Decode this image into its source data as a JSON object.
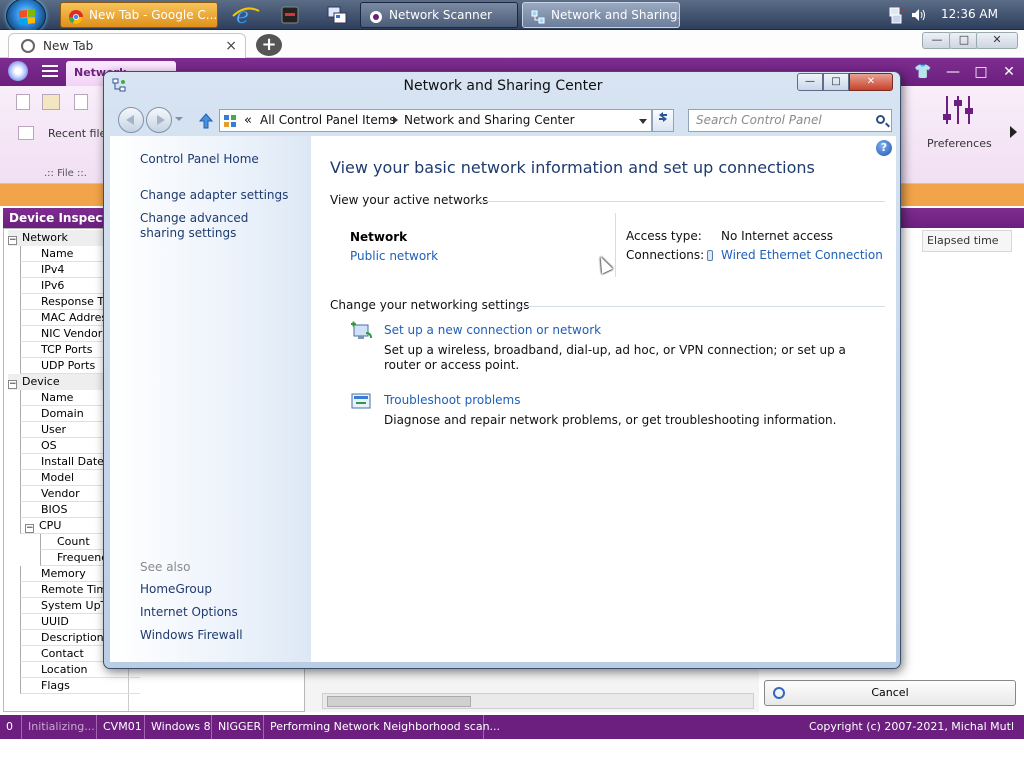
{
  "taskbar": {
    "buttons": [
      {
        "label": "New Tab - Google C...",
        "icon": "chrome-icon"
      },
      {
        "label": "Network Scanner",
        "icon": "network-scanner-icon"
      },
      {
        "label": "Network and Sharing...",
        "icon": "network-sharing-icon"
      }
    ],
    "pinned": [
      "internet-explorer-icon",
      "media-player-icon",
      "network-tool-icon"
    ],
    "clock": "12:36 AM",
    "tray_icons": [
      "network-tray-icon",
      "volume-icon"
    ]
  },
  "browser": {
    "tab_title": "New Tab",
    "close_glyph": "×",
    "new_tab_glyph": "+",
    "controls": [
      "—",
      "□",
      "✕"
    ]
  },
  "app": {
    "tab_label": "Network Scanner",
    "controls": [
      "👕",
      "—",
      "□",
      "✕"
    ],
    "ribbon": {
      "recent_files": "Recent files",
      "group_label": ".:: File ::.",
      "preferences": "Preferences"
    },
    "inspector": {
      "title": "Device Inspector",
      "groups": [
        {
          "label": "Network",
          "toggle": "−",
          "children": [
            "Name",
            "IPv4",
            "IPv6",
            "Response Time",
            "MAC Address",
            "NIC Vendor",
            "TCP Ports",
            "UDP Ports"
          ]
        },
        {
          "label": "Device",
          "toggle": "−",
          "children": [
            "Name",
            "Domain",
            "User",
            "OS",
            "Install Date",
            "Model",
            "Vendor",
            "BIOS"
          ]
        },
        {
          "label": "CPU",
          "toggle": "−",
          "children": [
            "Count",
            "Frequency"
          ]
        },
        {
          "extra": [
            "Memory",
            "Remote Time",
            "System UpTime",
            "UUID",
            "Description",
            "Contact",
            "Location",
            "Flags"
          ]
        }
      ]
    },
    "elapsed_header": "Elapsed time",
    "cancel_label": "Cancel",
    "status": [
      "0",
      "Initializing...",
      "CVM01",
      "Windows 8",
      "NIGGER",
      "Performing Network Neighborhood scan...",
      "Copyright (c) 2007-2021, Michal Mutl"
    ]
  },
  "window": {
    "title": "Network and Sharing Center",
    "controls": [
      "—",
      "□",
      "✕"
    ],
    "breadcrumb": {
      "chevron": "«",
      "items": [
        "All Control Panel Items",
        "Network and Sharing Center"
      ]
    },
    "search_placeholder": "Search Control Panel",
    "left_pane": {
      "home": "Control Panel Home",
      "links": [
        "Change adapter settings",
        "Change advanced sharing settings"
      ],
      "see_also_label": "See also",
      "see_also": [
        "HomeGroup",
        "Internet Options",
        "Windows Firewall"
      ]
    },
    "content": {
      "help_glyph": "?",
      "title": "View your basic network information and set up connections",
      "active_networks_header": "View your active networks",
      "network_name": "Network",
      "network_type": "Public network",
      "access_type_label": "Access type:",
      "access_type_value": "No Internet access",
      "connections_label": "Connections:",
      "connections_value": "Wired Ethernet Connection",
      "change_settings_header": "Change your networking settings",
      "tasks": [
        {
          "link": "Set up a new connection or network",
          "desc": "Set up a wireless, broadband, dial-up, ad hoc, or VPN connection; or set up a router or access point.",
          "icon": "new-connection-icon"
        },
        {
          "link": "Troubleshoot problems",
          "desc": "Diagnose and repair network problems, or get troubleshooting information.",
          "icon": "troubleshoot-icon"
        }
      ]
    }
  }
}
